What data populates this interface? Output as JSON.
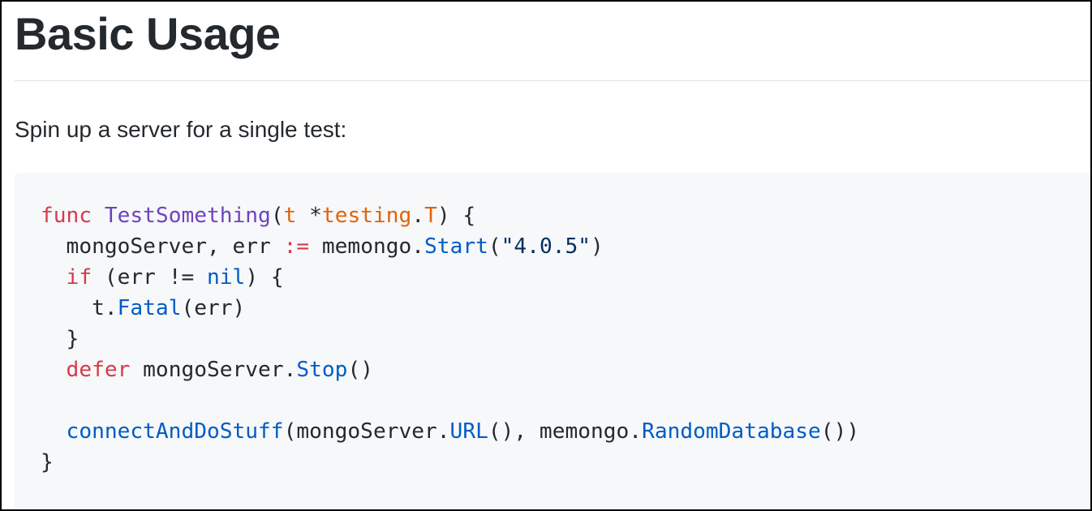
{
  "document": {
    "heading": "Basic Usage",
    "intro": "Spin up a server for a single test:"
  },
  "code": {
    "language": "go",
    "lines": [
      "func TestSomething(t *testing.T) {",
      "  mongoServer, err := memongo.Start(\"4.0.5\")",
      "  if (err != nil) {",
      "    t.Fatal(err)",
      "  }",
      "  defer mongoServer.Stop()",
      "",
      "  connectAndDoStuff(mongoServer.URL(), memongo.RandomDatabase())",
      "}"
    ],
    "tokens": {
      "l1_func": "func",
      "l1_name": "TestSomething",
      "l1_open": "(",
      "l1_t": "t",
      "l1_star": " *",
      "l1_testing": "testing",
      "l1_dot": ".",
      "l1_T": "T",
      "l1_close": ") {",
      "l2_indent": "  ",
      "l2_vars": "mongoServer, err ",
      "l2_op": ":=",
      "l2_pkg": " memongo.",
      "l2_start": "Start",
      "l2_open": "(",
      "l2_str": "\"4.0.5\"",
      "l2_close": ")",
      "l3_indent": "  ",
      "l3_if": "if",
      "l3_cond": " (err != ",
      "l3_nil": "nil",
      "l3_close": ") {",
      "l4_indent": "    ",
      "l4_t": "t.",
      "l4_fatal": "Fatal",
      "l4_args": "(err)",
      "l5_text": "  }",
      "l6_indent": "  ",
      "l6_defer": "defer",
      "l6_obj": " mongoServer.",
      "l6_stop": "Stop",
      "l6_args": "()",
      "l8_indent": "  ",
      "l8_call": "connectAndDoStuff",
      "l8_a1": "(mongoServer.",
      "l8_url": "URL",
      "l8_a2": "(), memongo.",
      "l8_rand": "RandomDatabase",
      "l8_a3": "())",
      "l9_text": "}"
    }
  },
  "colors": {
    "keyword": "#d73a49",
    "function_name": "#6f42c1",
    "parameter": "#e36209",
    "method_call": "#005cc5",
    "string": "#032f62",
    "text": "#24292e",
    "code_background": "#f6f8fa",
    "rule": "#dfe2e5"
  }
}
